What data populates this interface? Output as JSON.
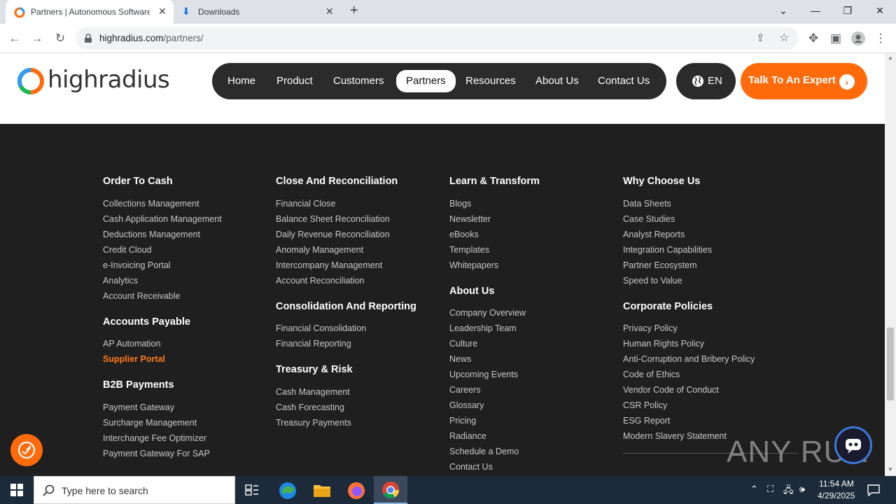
{
  "browser": {
    "tabs": [
      {
        "title": "Partners | Autonomous Software",
        "active": true
      },
      {
        "title": "Downloads",
        "active": false
      }
    ],
    "url_domain": "highradius.com",
    "url_path": "/partners/"
  },
  "site": {
    "logo_text": "highradius",
    "nav": [
      "Home",
      "Product",
      "Customers",
      "Partners",
      "Resources",
      "About Us",
      "Contact Us"
    ],
    "active_nav": "Partners",
    "lang": "EN",
    "cta": "Talk To An Expert"
  },
  "footer": {
    "col1": {
      "s1_heading": "Order To Cash",
      "s1_links": [
        "Collections Management",
        "Cash Application Management",
        "Deductions Management",
        "Credit Cloud",
        "e-Invoicing Portal",
        "Analytics",
        "Account Receivable"
      ],
      "s2_heading": "Accounts Payable",
      "s2_links": [
        "AP Automation",
        "Supplier Portal"
      ],
      "s3_heading": "B2B Payments",
      "s3_links": [
        "Payment Gateway",
        "Surcharge Management",
        "Interchange Fee Optimizer",
        "Payment Gateway For SAP"
      ]
    },
    "col2": {
      "s1_heading": "Close And Reconciliation",
      "s1_links": [
        "Financial Close",
        "Balance Sheet Reconciliation",
        "Daily Revenue Reconciliation",
        "Anomaly Management",
        "Intercompany Management",
        "Account Reconciliation"
      ],
      "s2_heading": "Consolidation And Reporting",
      "s2_links": [
        "Financial Consolidation",
        "Financial Reporting"
      ],
      "s3_heading": "Treasury & Risk",
      "s3_links": [
        "Cash Management",
        "Cash Forecasting",
        "Treasury Payments"
      ]
    },
    "col3": {
      "s1_heading": "Learn & Transform",
      "s1_links": [
        "Blogs",
        "Newsletter",
        "eBooks",
        "Templates",
        "Whitepapers"
      ],
      "s2_heading": "About Us",
      "s2_links": [
        "Company Overview",
        "Leadership Team",
        "Culture",
        "News",
        "Upcoming Events",
        "Careers",
        "Glossary",
        "Pricing",
        "Radiance",
        "Schedule a Demo",
        "Contact Us"
      ]
    },
    "col4": {
      "s1_heading": "Why Choose Us",
      "s1_links": [
        "Data Sheets",
        "Case Studies",
        "Analyst Reports",
        "Integration Capabilities",
        "Partner Ecosystem",
        "Speed to Value"
      ],
      "s2_heading": "Corporate Policies",
      "s2_links": [
        "Privacy Policy",
        "Human Rights Policy",
        "Anti-Corruption and Bribery Policy",
        "Code of Ethics",
        "Vendor Code of Conduct",
        "CSR Policy",
        "ESG Report",
        "Modern Slavery Statement"
      ]
    }
  },
  "watermark": "ANY RUN",
  "taskbar": {
    "search_placeholder": "Type here to search",
    "time": "11:54 AM",
    "date": "4/29/2025"
  },
  "colors": {
    "accent_orange": "#ff6b0b",
    "footer_bg": "#1f1f1f",
    "nav_bg": "#2b2b2b"
  }
}
